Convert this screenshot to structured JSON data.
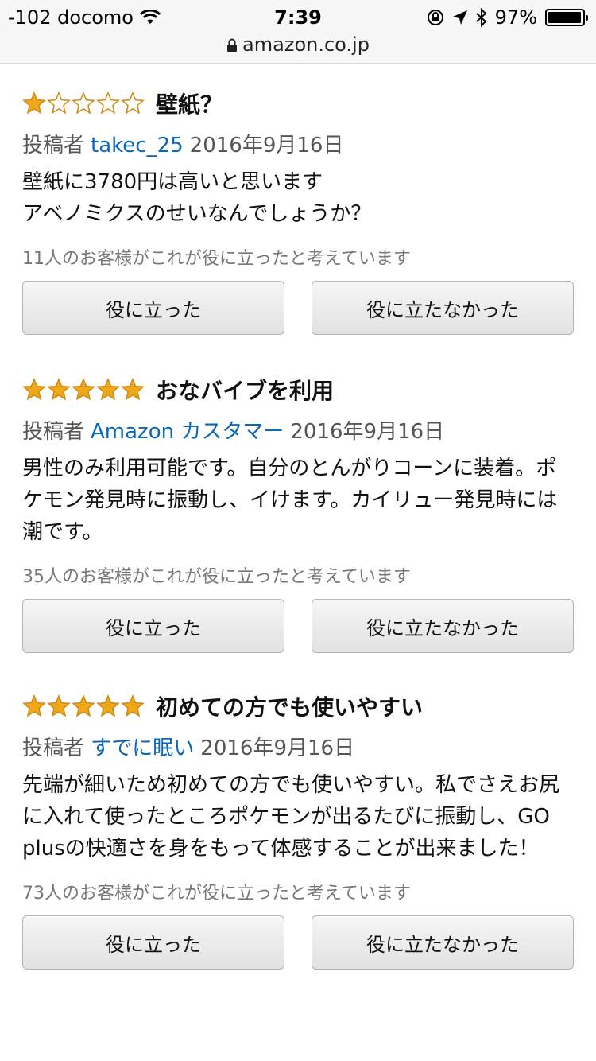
{
  "status_bar": {
    "carrier": "-102 docomo",
    "time": "7:39",
    "battery": "97%",
    "url": "amazon.co.jp"
  },
  "colors": {
    "star_filled": "#f0a81b",
    "star_empty_outline": "#d08a10",
    "author_link": "#0a66b8"
  },
  "reviews": [
    {
      "rating": 1,
      "title": "壁紙？",
      "author_prefix": "投稿者",
      "author": "takec_25",
      "date": "2016年9月16日",
      "body": "壁紙に3780円は高いと思います\nアベノミクスのせいなんでしょうか？",
      "helpful_text": "11人のお客様がこれが役に立ったと考えています",
      "helpful_button": "役に立った",
      "not_helpful_button": "役に立たなかった"
    },
    {
      "rating": 5,
      "title": "おなバイブを利用",
      "author_prefix": "投稿者",
      "author": "Amazon カスタマー",
      "date": "2016年9月16日",
      "body": "男性のみ利用可能です。自分のとんがりコーンに装着。ポケモン発見時に振動し、イけます。カイリュー発見時には潮です。",
      "helpful_text": "35人のお客様がこれが役に立ったと考えています",
      "helpful_button": "役に立った",
      "not_helpful_button": "役に立たなかった"
    },
    {
      "rating": 5,
      "title": "初めての方でも使いやすい",
      "author_prefix": "投稿者",
      "author": "すでに眠い",
      "date": "2016年9月16日",
      "body": "先端が細いため初めての方でも使いやすい。私でさえお尻に入れて使ったところポケモンが出るたびに振動し、GO plusの快適さを身をもって体感することが出来ました！",
      "helpful_text": "73人のお客様がこれが役に立ったと考えています",
      "helpful_button": "役に立った",
      "not_helpful_button": "役に立たなかった"
    }
  ]
}
